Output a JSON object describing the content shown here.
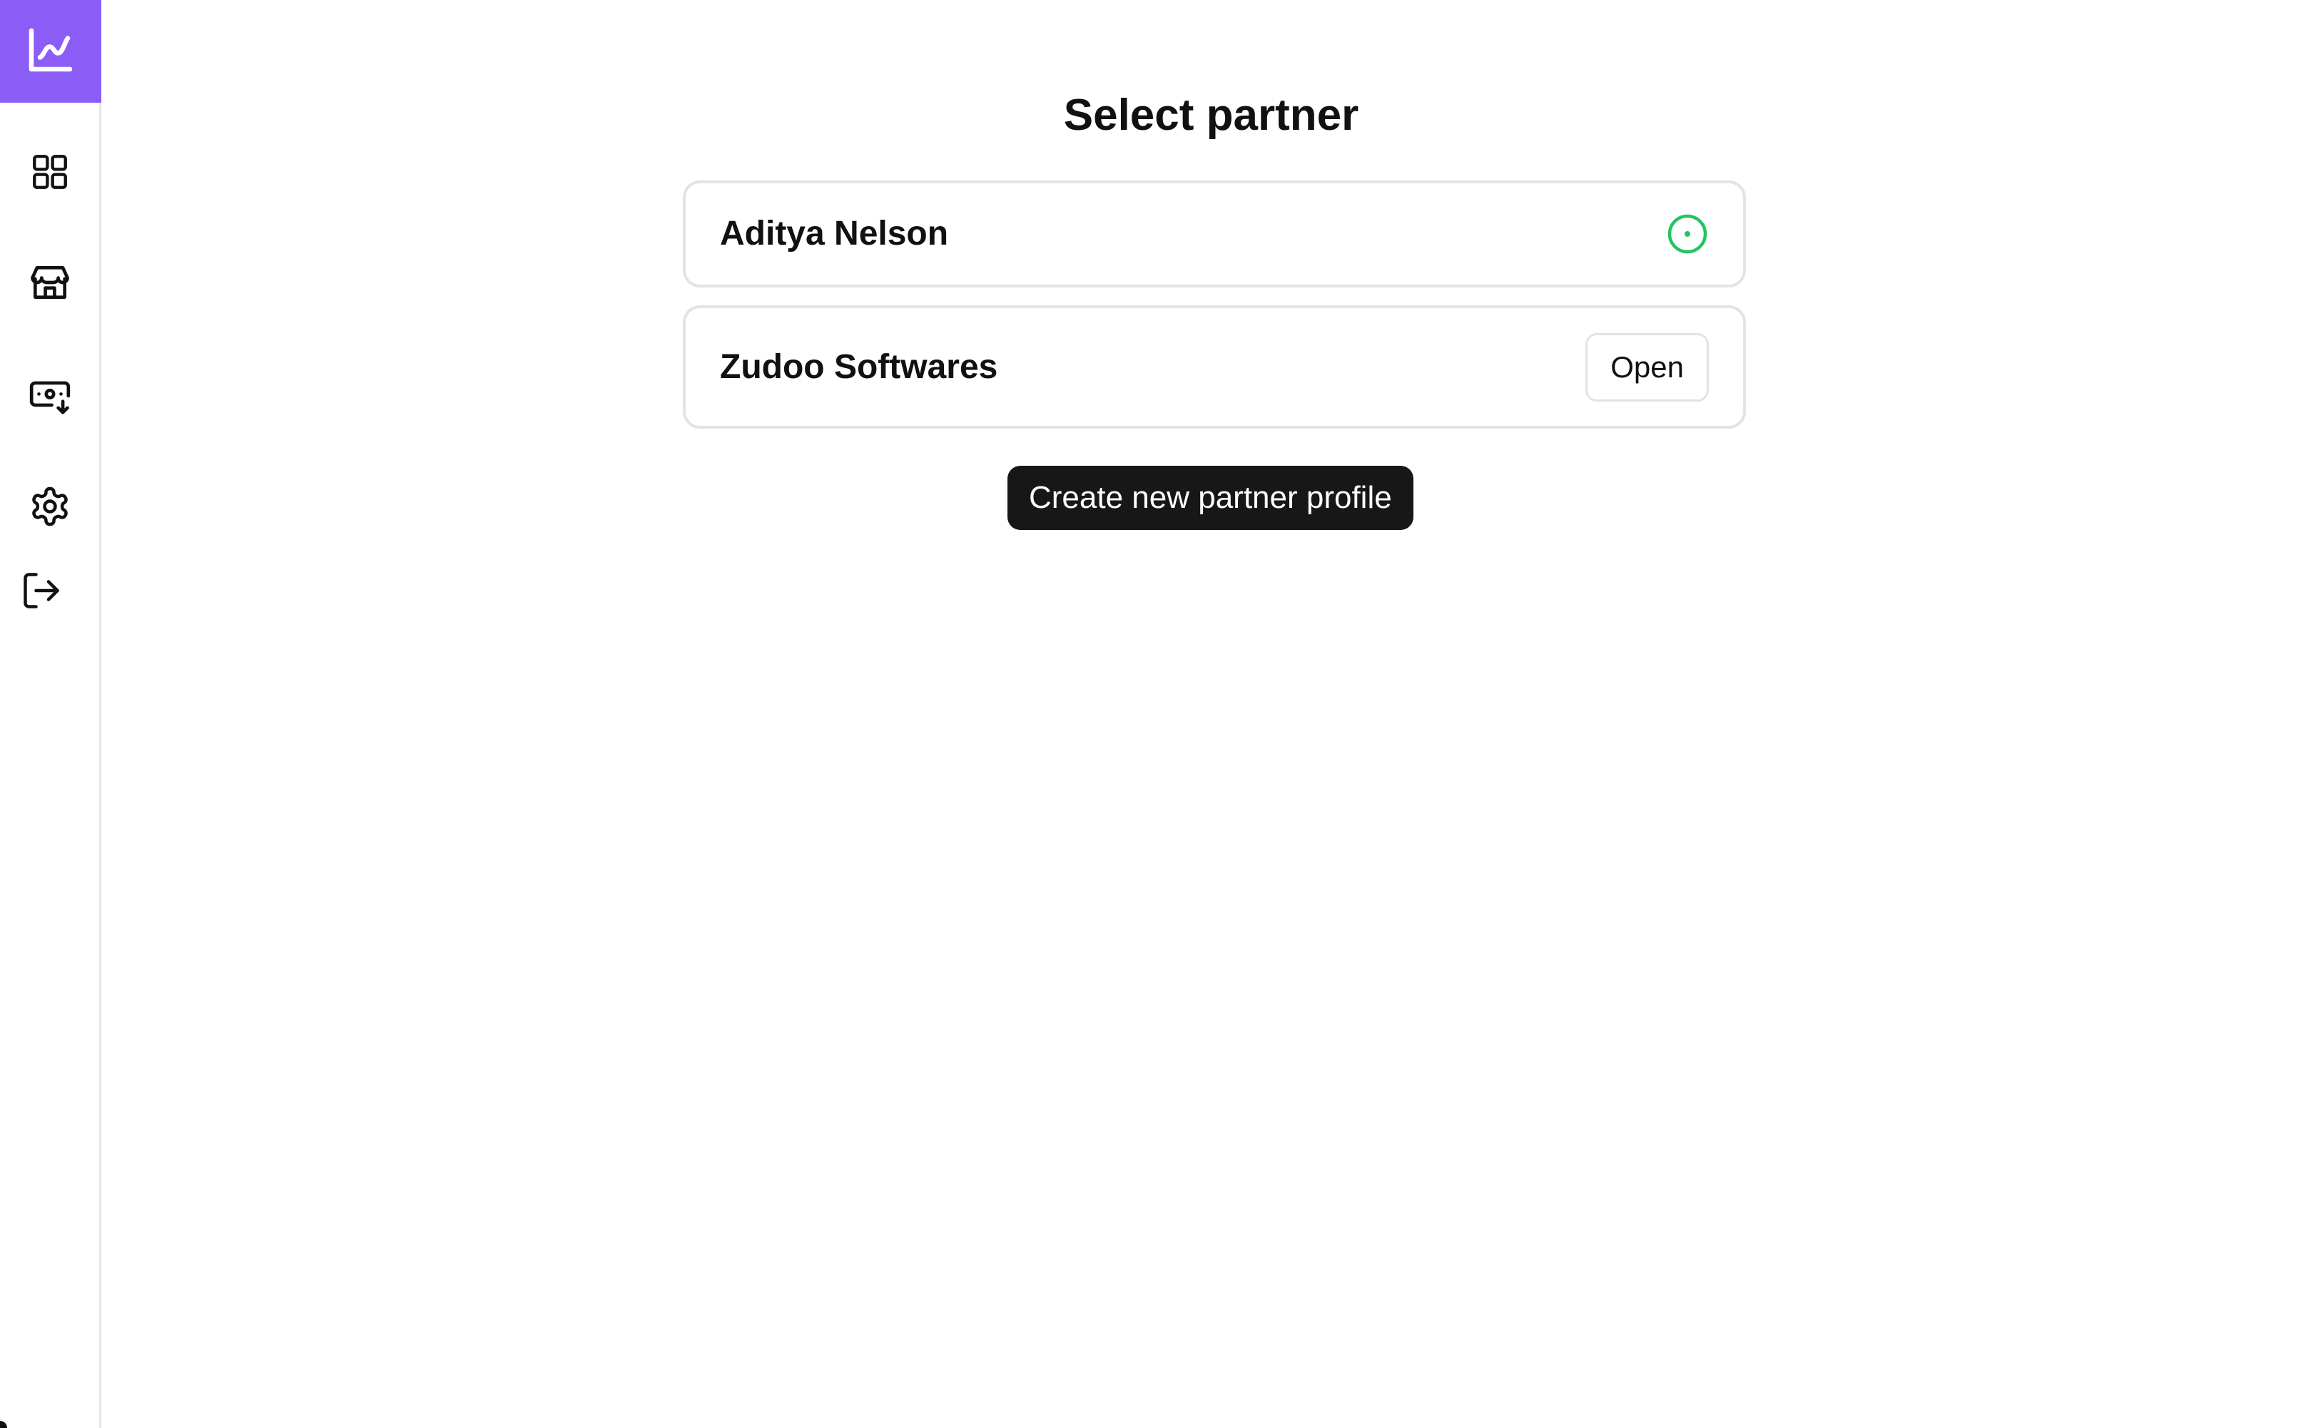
{
  "colors": {
    "accent": "#8b5cf6",
    "selected_indicator": "#22c55e",
    "primary_button_bg": "#171717",
    "border": "#e3e3e3"
  },
  "sidebar": {
    "logo_icon": "line-chart-icon",
    "items": [
      {
        "name": "dashboard",
        "icon": "grid-icon"
      },
      {
        "name": "store",
        "icon": "store-icon"
      },
      {
        "name": "payouts",
        "icon": "money-download-icon"
      },
      {
        "name": "settings",
        "icon": "gear-icon"
      },
      {
        "name": "logout",
        "icon": "logout-icon"
      }
    ]
  },
  "main": {
    "title": "Select partner",
    "partners": [
      {
        "name": "Aditya Nelson",
        "selected": true,
        "indicator_icon": "radio-selected-icon"
      },
      {
        "name": "Zudoo Softwares",
        "selected": false,
        "action_label": "Open"
      }
    ],
    "create_label": "Create new partner profile"
  }
}
